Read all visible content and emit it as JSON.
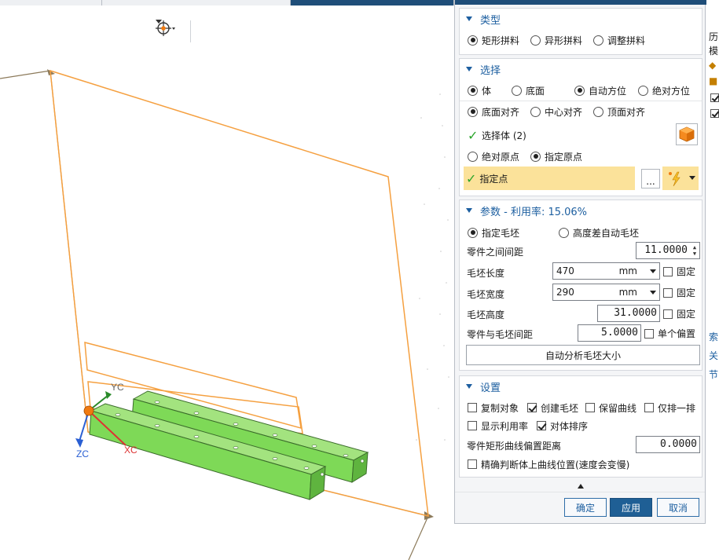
{
  "colors": {
    "accent": "#1d5fa0",
    "highlight": "#fbe29a",
    "part_green": "#7ed957",
    "outline_orange": "#f5a040"
  },
  "viewport": {
    "snap_icon": "crosshair-snap-icon",
    "triad": {
      "yc": "YC",
      "xc": "XC",
      "zc": "ZC"
    }
  },
  "type_section": {
    "title": "类型",
    "options": [
      "矩形拼料",
      "异形拼料",
      "调整拼料"
    ],
    "selected": "矩形拼料"
  },
  "select_section": {
    "title": "选择",
    "row1": [
      "体",
      "底面",
      "自动方位",
      "绝对方位"
    ],
    "row2": [
      "底面对齐",
      "中心对齐",
      "顶面对齐"
    ],
    "select_body": "选择体 (2)",
    "row3": [
      "绝对原点",
      "指定原点"
    ],
    "specify_point": "指定点",
    "dots": "..."
  },
  "params_section": {
    "title": "参数 - 利用率: 15.06%",
    "options": [
      "指定毛坯",
      "高度差自动毛坯"
    ],
    "part_spacing_label": "零件之间间距",
    "part_spacing_value": "11.0000",
    "blank_length_label": "毛坯长度",
    "blank_length_value": "470",
    "blank_width_label": "毛坯宽度",
    "blank_width_value": "290",
    "unit": "mm",
    "fixed_label": "固定",
    "blank_height_label": "毛坯高度",
    "blank_height_value": "31.0000",
    "part_blank_spacing_label": "零件与毛坯间距",
    "part_blank_spacing_value": "5.0000",
    "single_offset_label": "单个偏置",
    "analyze_button": "自动分析毛坯大小"
  },
  "settings_section": {
    "title": "设置",
    "checks": [
      {
        "label": "复制对象",
        "checked": false
      },
      {
        "label": "创建毛坯",
        "checked": true
      },
      {
        "label": "保留曲线",
        "checked": false
      },
      {
        "label": "仅排一排",
        "checked": false
      },
      {
        "label": "显示利用率",
        "checked": false
      },
      {
        "label": "对体排序",
        "checked": true
      }
    ],
    "offset_label": "零件矩形曲线偏置距离",
    "offset_value": "0.0000",
    "precise_label": "精确判断体上曲线位置(速度会变慢)"
  },
  "footer": {
    "ok": "确定",
    "apply": "应用",
    "cancel": "取消"
  },
  "right_stub": [
    "历",
    "模",
    "索",
    "关",
    "节"
  ]
}
